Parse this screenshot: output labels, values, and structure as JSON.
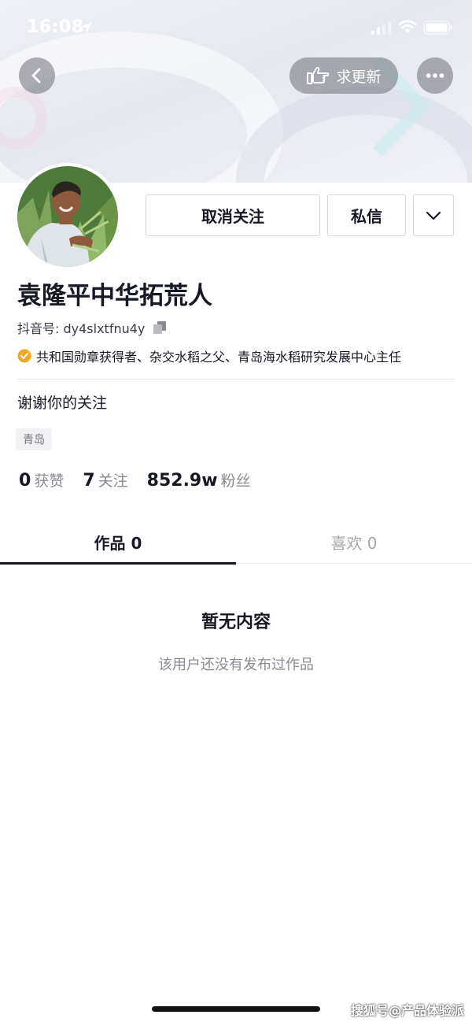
{
  "status_bar": {
    "time": "16:08"
  },
  "header": {
    "request_update_label": "求更新"
  },
  "profile": {
    "unfollow_label": "取消关注",
    "message_label": "私信",
    "name": "袁隆平中华拓荒人",
    "douyin_id_label": "抖音号:",
    "douyin_id": "dy4slxtfnu4y",
    "verification": "共和国勋章获得者、杂交水稻之父、青岛海水稻研究发展中心主任",
    "bio": "谢谢你的关注",
    "tag": "青岛"
  },
  "stats": [
    {
      "num": "0",
      "label": "获赞"
    },
    {
      "num": "7",
      "label": "关注"
    },
    {
      "num": "852.9w",
      "label": "粉丝"
    }
  ],
  "tabs": [
    {
      "label": "作品 0"
    },
    {
      "label": "喜欢 0"
    }
  ],
  "empty_state": {
    "title": "暂无内容",
    "subtitle": "该用户还没有发布过作品"
  },
  "watermark": "搜狐号@产品体验派",
  "colors": {
    "verify_badge": "#f5a623",
    "tab_indicator": "#161823"
  }
}
